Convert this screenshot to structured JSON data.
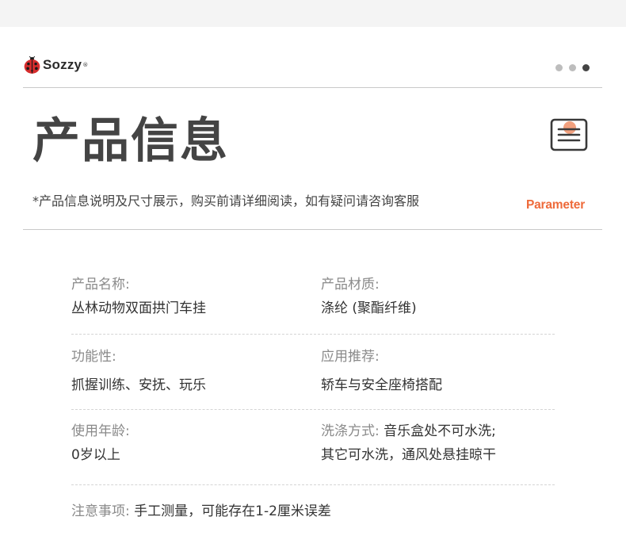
{
  "brand": {
    "name": "Sozzy",
    "reg": "®"
  },
  "colors": {
    "accent": "#ee6a3a",
    "title": "#444444",
    "label": "#8a8a8a",
    "value": "#333333"
  },
  "header": {
    "title": "产品信息",
    "subtitle": "*产品信息说明及尺寸展示，购买前请详细阅读，如有疑问请咨询客服",
    "tag": "Parameter",
    "icon": "list-icon"
  },
  "carousel": {
    "active_index": 2,
    "count": 3
  },
  "info": {
    "name_label": "产品名称:",
    "name_value": "丛林动物双面拱门车挂",
    "material_label": "产品材质:",
    "material_value": "涤纶 (聚酯纤维)",
    "function_label": "功能性:",
    "function_value": "抓握训练、安抚、玩乐",
    "application_label": "应用推荐:",
    "application_value": "轿车与安全座椅搭配",
    "age_label": "使用年龄:",
    "age_value": "0岁以上",
    "wash_label": "洗涤方式:",
    "wash_line1": " 音乐盒处不可水洗;",
    "wash_line2": "其它可水洗，通风处悬挂晾干",
    "notes_label": "注意事项:",
    "notes_value": " 手工测量，可能存在1-2厘米误差"
  }
}
